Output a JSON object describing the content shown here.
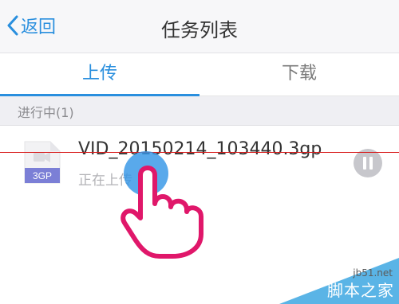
{
  "header": {
    "back_label": "返回",
    "title": "任务列表"
  },
  "tabs": [
    {
      "label": "上传",
      "active": true
    },
    {
      "label": "下载",
      "active": false
    }
  ],
  "section": {
    "label": "进行中(1)"
  },
  "task": {
    "file_type": "3GP",
    "file_name": "VID_20150214_103440.3gp",
    "status": "正在上传"
  },
  "watermark": {
    "url": "jb51.net",
    "name": "脚本之家"
  },
  "colors": {
    "accent": "#2a8fde",
    "file_icon_badge": "#7b7fd6",
    "hand_outline": "#e0176a",
    "red_line": "#d81b1b"
  },
  "icons": {
    "back": "chevron-left-icon",
    "file": "video-file-icon",
    "pause": "pause-icon",
    "hand": "pointing-hand-icon"
  }
}
